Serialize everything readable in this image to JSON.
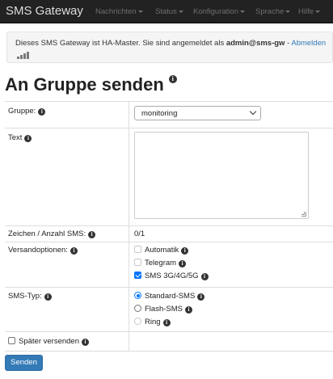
{
  "navbar": {
    "brand": "SMS Gateway",
    "items": [
      "Nachrichten",
      "Status",
      "Konfiguration",
      "Sprache",
      "Hilfe"
    ]
  },
  "alert": {
    "text_prefix": "Dieses SMS Gateway ist HA-Master. Sie sind angemeldet als ",
    "user": "admin@sms-gw",
    "separator": " - ",
    "logout_link": "Abmelden"
  },
  "page": {
    "title": "An Gruppe senden"
  },
  "form": {
    "group": {
      "label": "Gruppe:",
      "selected": "monitoring"
    },
    "text": {
      "label": "Text",
      "value": ""
    },
    "char_count": {
      "label": "Zeichen / Anzahl SMS:",
      "value": "0/1"
    },
    "shipping": {
      "label": "Versandoptionen:",
      "options": [
        {
          "label": "Automatik",
          "checked": false,
          "disabled": true
        },
        {
          "label": "Telegram",
          "checked": false,
          "disabled": true
        },
        {
          "label": "SMS 3G/4G/5G",
          "checked": true,
          "disabled": false
        }
      ]
    },
    "sms_type": {
      "label": "SMS-Typ:",
      "options": [
        {
          "label": "Standard-SMS",
          "selected": true,
          "disabled": false
        },
        {
          "label": "Flash-SMS",
          "selected": false,
          "disabled": false
        },
        {
          "label": "Ring",
          "selected": false,
          "disabled": true
        }
      ]
    },
    "later": {
      "label": "Später versenden",
      "checked": false
    },
    "submit": "Senden"
  },
  "colors": {
    "navbar": "#222222",
    "primary": "#337ab7",
    "accent": "#0075ff"
  }
}
